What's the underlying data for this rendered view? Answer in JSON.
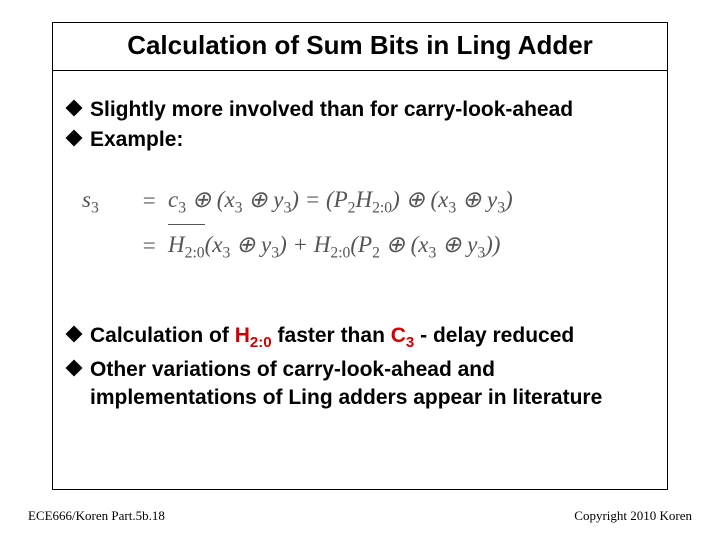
{
  "title": "Calculation of Sum Bits in Ling Adder",
  "bullets_top": [
    {
      "text": "Slightly more involved than for carry-look-ahead"
    },
    {
      "text": "Example:"
    }
  ],
  "equations": {
    "lhs": "s",
    "lhs_sub": "3",
    "line1_pre": "c",
    "line1_sub1": "3",
    "line1_mid": " ⊕ (x",
    "line1_sub2": "3",
    "line1_mid2": " ⊕ y",
    "line1_sub3": "3",
    "line1_after": ") = (P",
    "line1_sub4": "2",
    "line1_H": "H",
    "line1_sub5": "2:0",
    "line1_end": ") ⊕ (x",
    "line1_sub6": "3",
    "line1_end2": " ⊕ y",
    "line1_sub7": "3",
    "line1_close": ")",
    "line2_bar_H": "H",
    "line2_bar_sub": "2:0",
    "line2_a": "(x",
    "line2_sub1": "3",
    "line2_b": " ⊕ y",
    "line2_sub2": "3",
    "line2_c": ") + H",
    "line2_sub3": "2:0",
    "line2_d": "(P",
    "line2_sub4": "2",
    "line2_e": " ⊕ (x",
    "line2_sub5": "3",
    "line2_f": " ⊕ y",
    "line2_sub6": "3",
    "line2_g": "))"
  },
  "bullets_bottom": {
    "b1_pre": "Calculation of ",
    "b1_H": "H",
    "b1_Hsub": "2:0",
    "b1_mid": "  faster than ",
    "b1_C": "C",
    "b1_Csub": "3",
    "b1_post": " - delay reduced",
    "b2": "Other variations of carry-look-ahead and implementations of Ling adders appear in literature"
  },
  "footer": {
    "left": "ECE666/Koren Part.5b.18",
    "right": "Copyright 2010 Koren"
  }
}
